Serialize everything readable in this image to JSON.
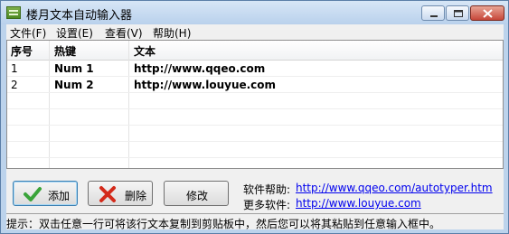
{
  "window": {
    "title": "楼月文本自动输入器"
  },
  "menu": {
    "items": [
      {
        "label": "文件(F)"
      },
      {
        "label": "设置(E)"
      },
      {
        "label": "查看(V)"
      },
      {
        "label": "帮助(H)"
      }
    ]
  },
  "table": {
    "columns": [
      "序号",
      "热键",
      "文本"
    ],
    "rows": [
      {
        "index": "1",
        "hotkey": "Num 1",
        "text": "http://www.qqeo.com"
      },
      {
        "index": "2",
        "hotkey": "Num 2",
        "text": "http://www.louyue.com"
      }
    ]
  },
  "buttons": {
    "add": "添加",
    "delete": "删除",
    "edit": "修改"
  },
  "help": {
    "help_label": "软件帮助:",
    "help_url": "http://www.qqeo.com/autotyper.htm",
    "more_label": "更多软件:",
    "more_url": "http://www.louyue.com"
  },
  "status": {
    "text": "提示：双击任意一行可将该行文本复制到剪贴板中，然后您可以将其粘贴到任意输入框中。"
  },
  "icons": {
    "app": "app-icon",
    "minimize": "minimize-icon",
    "maximize": "maximize-icon",
    "close": "close-icon",
    "add": "check-icon",
    "delete": "x-icon"
  },
  "colors": {
    "link": "#0000ee",
    "add_check": "#3aa43a",
    "delete_x": "#d42a1a"
  }
}
